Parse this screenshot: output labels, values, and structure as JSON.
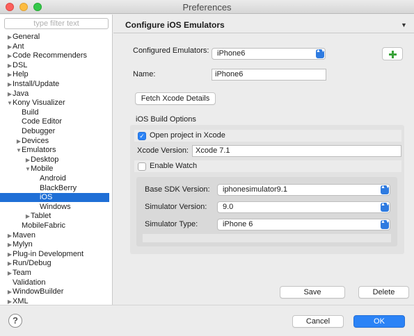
{
  "window": {
    "title": "Preferences"
  },
  "sidebar": {
    "filter_placeholder": "type filter text",
    "items": [
      {
        "label": "General",
        "arrow": "▶",
        "indent": 0
      },
      {
        "label": "Ant",
        "arrow": "▶",
        "indent": 0
      },
      {
        "label": "Code Recommenders",
        "arrow": "▶",
        "indent": 0
      },
      {
        "label": "DSL",
        "arrow": "▶",
        "indent": 0
      },
      {
        "label": "Help",
        "arrow": "▶",
        "indent": 0
      },
      {
        "label": "Install/Update",
        "arrow": "▶",
        "indent": 0
      },
      {
        "label": "Java",
        "arrow": "▶",
        "indent": 0
      },
      {
        "label": "Kony Visualizer",
        "arrow": "▼",
        "indent": 0
      },
      {
        "label": "Build",
        "arrow": "",
        "indent": 1
      },
      {
        "label": "Code Editor",
        "arrow": "",
        "indent": 1
      },
      {
        "label": "Debugger",
        "arrow": "",
        "indent": 1
      },
      {
        "label": "Devices",
        "arrow": "▶",
        "indent": 1
      },
      {
        "label": "Emulators",
        "arrow": "▼",
        "indent": 1
      },
      {
        "label": "Desktop",
        "arrow": "▶",
        "indent": 2
      },
      {
        "label": "Mobile",
        "arrow": "▼",
        "indent": 2
      },
      {
        "label": "Android",
        "arrow": "",
        "indent": 3
      },
      {
        "label": "BlackBerry",
        "arrow": "",
        "indent": 3
      },
      {
        "label": "iOS",
        "arrow": "",
        "indent": 3,
        "selected": true
      },
      {
        "label": "Windows",
        "arrow": "",
        "indent": 3
      },
      {
        "label": "Tablet",
        "arrow": "▶",
        "indent": 2
      },
      {
        "label": "MobileFabric",
        "arrow": "",
        "indent": 1
      },
      {
        "label": "Maven",
        "arrow": "▶",
        "indent": 0
      },
      {
        "label": "Mylyn",
        "arrow": "▶",
        "indent": 0
      },
      {
        "label": "Plug-in Development",
        "arrow": "▶",
        "indent": 0
      },
      {
        "label": "Run/Debug",
        "arrow": "▶",
        "indent": 0
      },
      {
        "label": "Team",
        "arrow": "▶",
        "indent": 0
      },
      {
        "label": "Validation",
        "arrow": "",
        "indent": 0
      },
      {
        "label": "WindowBuilder",
        "arrow": "▶",
        "indent": 0
      },
      {
        "label": "XML",
        "arrow": "▶",
        "indent": 0
      }
    ]
  },
  "panel": {
    "title": "Configure iOS Emulators",
    "menu_arrow": "▼",
    "configured_label": "Configured Emulators:",
    "configured_value": "iPhone6",
    "name_label": "Name:",
    "name_value": "iPhone6",
    "fetch_button": "Fetch Xcode Details",
    "build_options_label": "iOS Build Options",
    "open_xcode_label": "Open project in Xcode",
    "xcode_version_label": "Xcode Version:",
    "xcode_version_value": "Xcode 7.1",
    "enable_watch_label": "Enable Watch",
    "base_sdk_label": "Base SDK Version:",
    "base_sdk_value": "iphonesimulator9.1",
    "sim_version_label": "Simulator Version:",
    "sim_version_value": "9.0",
    "sim_type_label": "Simulator Type:",
    "sim_type_value": "iPhone 6",
    "save_button": "Save",
    "delete_button": "Delete",
    "checkmark": "✓",
    "select_arrows": "▲▼"
  },
  "footer": {
    "help_glyph": "?",
    "cancel_button": "Cancel",
    "ok_button": "OK"
  },
  "colors": {
    "accent": "#2b83f6",
    "selection": "#1f6fd6"
  }
}
